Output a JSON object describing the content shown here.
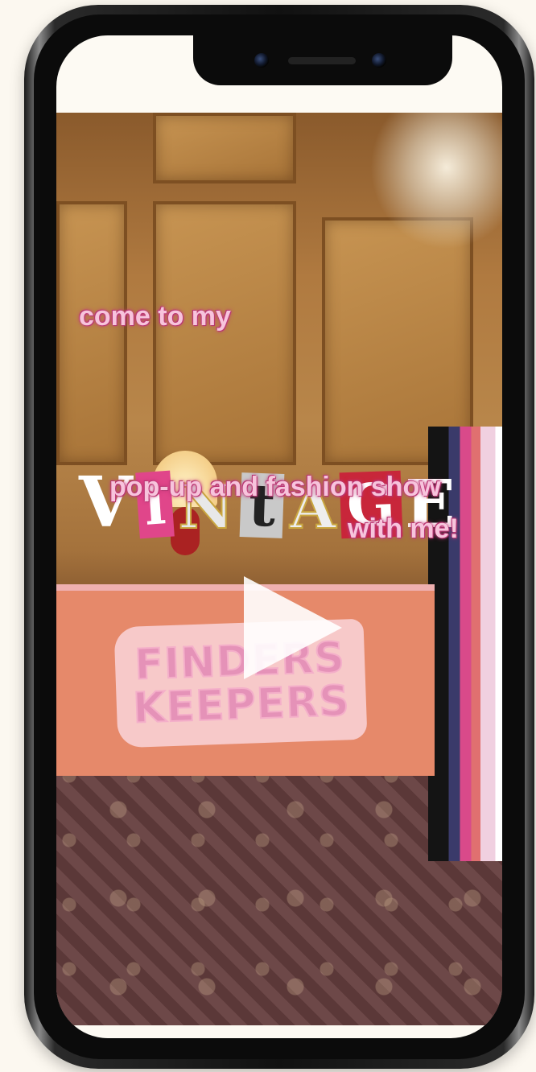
{
  "video": {
    "caption_top": "come to my",
    "title_letters": [
      "V",
      "i",
      "N",
      "t",
      "A",
      "G",
      "E"
    ],
    "caption_middle": "pop-up and fashion show",
    "caption_bottom": "with me!",
    "sign_line1": "FINDERS",
    "sign_line2": "KEEPERS"
  },
  "icons": {
    "play": "play-icon"
  },
  "colors": {
    "caption_pink": "#f7c4dc",
    "caption_outline": "#c23a7a",
    "phone_bezel": "#0b0b0b",
    "background": "#fcf8f0"
  }
}
